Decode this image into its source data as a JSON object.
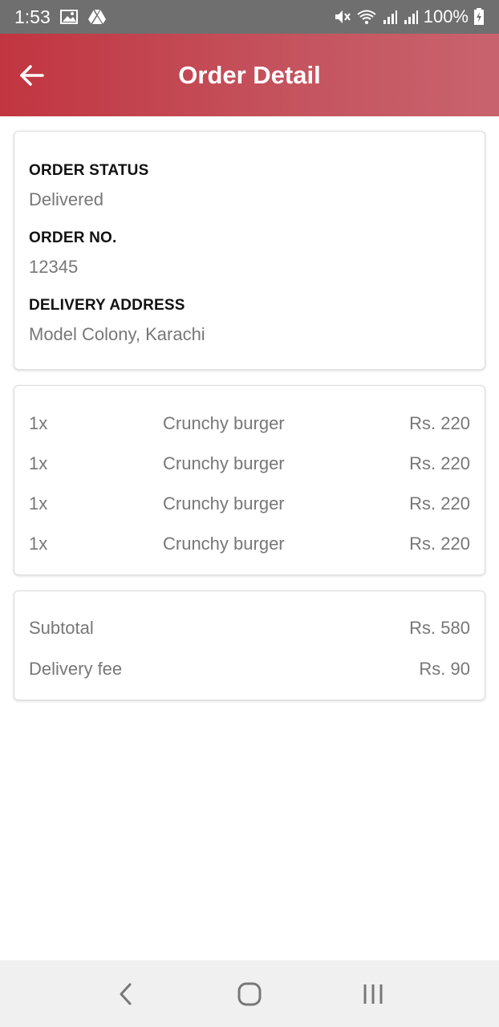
{
  "status_bar": {
    "time": "1:53",
    "battery": "100%",
    "icons": [
      "image-icon",
      "drive-icon",
      "mute-icon",
      "wifi-icon",
      "signal-icon",
      "signal-icon",
      "battery-charging-icon"
    ]
  },
  "app_bar": {
    "title": "Order Detail",
    "back_icon": "arrow-left-icon",
    "colors": {
      "start": "#c13540",
      "end": "#c8636d"
    }
  },
  "order_info": {
    "status_label": "ORDER STATUS",
    "status_value": "Delivered",
    "number_label": "ORDER NO.",
    "number_value": "12345",
    "address_label": "DELIVERY ADDRESS",
    "address_value": "Model Colony, Karachi"
  },
  "items": [
    {
      "qty": "1x",
      "name": "Crunchy burger",
      "price": "Rs. 220"
    },
    {
      "qty": "1x",
      "name": "Crunchy burger",
      "price": "Rs. 220"
    },
    {
      "qty": "1x",
      "name": "Crunchy burger",
      "price": "Rs. 220"
    },
    {
      "qty": "1x",
      "name": "Crunchy burger",
      "price": "Rs. 220"
    }
  ],
  "totals": {
    "subtotal_label": "Subtotal",
    "subtotal_value": "Rs. 580",
    "delivery_label": "Delivery fee",
    "delivery_value": "Rs. 90"
  },
  "nav_bar": {
    "icons": [
      "back-nav-icon",
      "home-nav-icon",
      "recents-nav-icon"
    ]
  }
}
